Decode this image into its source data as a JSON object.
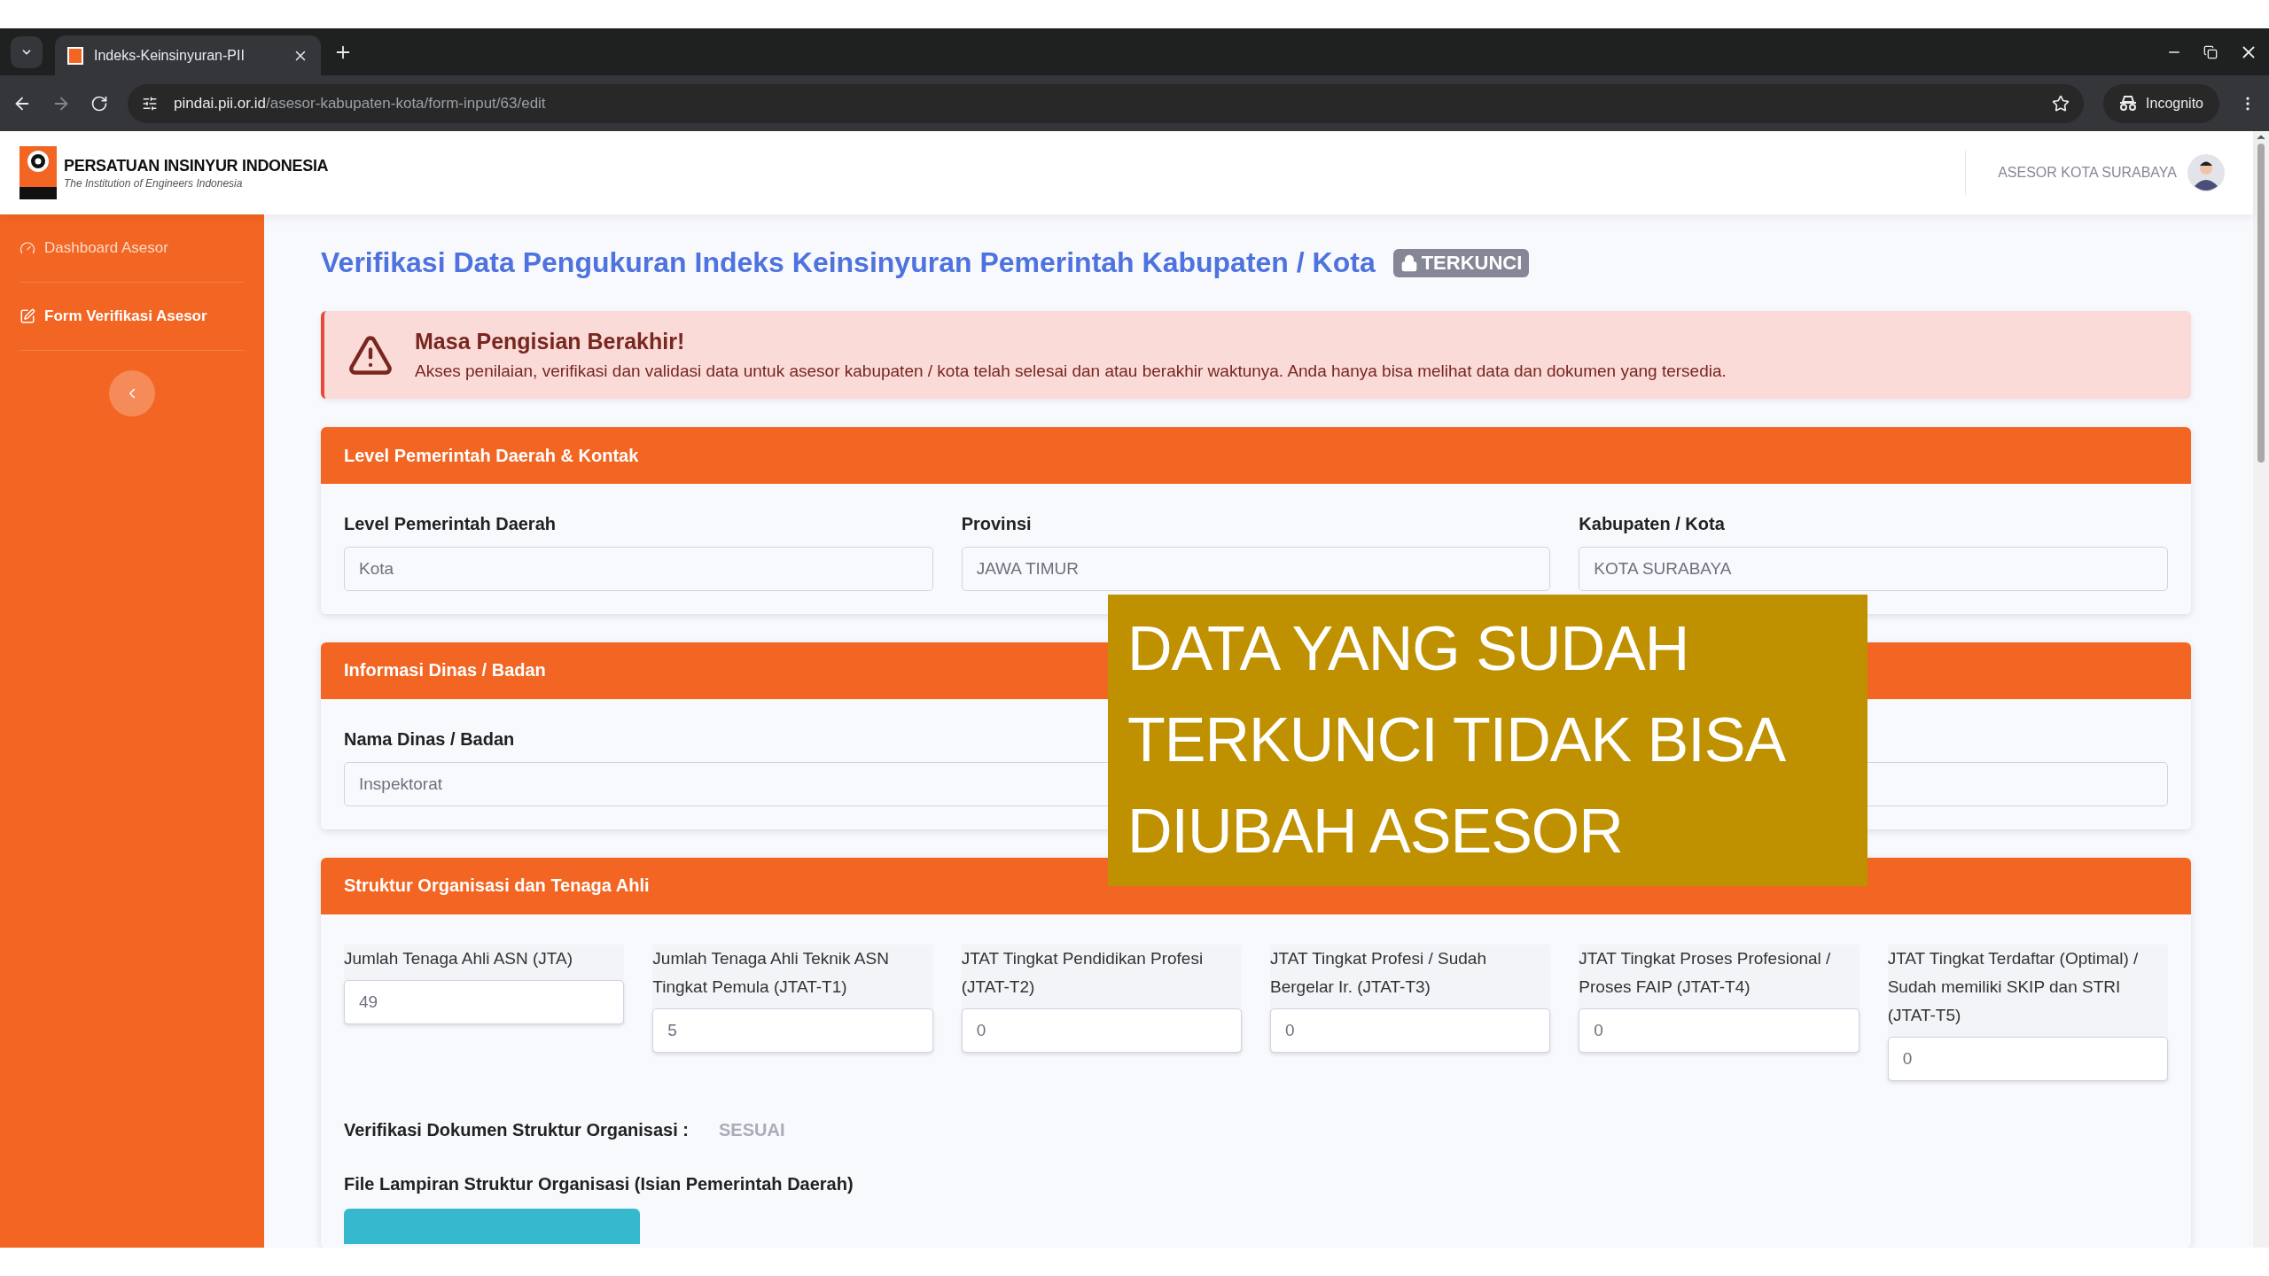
{
  "browser": {
    "tab_title": "Indeks-Keinsinyuran-PII",
    "url_host": "pindai.pii.or.id",
    "url_path": "/asesor-kabupaten-kota/form-input/63/edit",
    "incognito_label": "Incognito"
  },
  "header": {
    "org_name": "PERSATUAN INSINYUR INDONESIA",
    "org_subtitle": "The Institution of Engineers Indonesia",
    "user_name": "ASESOR KOTA SURABAYA"
  },
  "sidebar": {
    "items": [
      {
        "label": "Dashboard Asesor",
        "selected": false
      },
      {
        "label": "Form Verifikasi Asesor",
        "selected": true
      }
    ]
  },
  "page_title": "Verifikasi Data Pengukuran Indeks Keinsinyuran Pemerintah Kabupaten / Kota",
  "status_badge": "TERKUNCI",
  "alert": {
    "title": "Masa Pengisian Berakhir!",
    "message": "Akses penilaian, verifikasi dan validasi data untuk asesor kabupaten / kota telah selesai dan atau berakhir waktunya. Anda hanya bisa melihat data dan dokumen yang tersedia."
  },
  "sections": [
    {
      "kind": "fields",
      "title": "Level Pemerintah Daerah & Kontak",
      "fields": [
        {
          "label": "Level Pemerintah Daerah",
          "value": "Kota"
        },
        {
          "label": "Provinsi",
          "value": "JAWA TIMUR"
        },
        {
          "label": "Kabupaten / Kota",
          "value": "KOTA SURABAYA"
        }
      ]
    },
    {
      "kind": "fields",
      "title": "Informasi Dinas / Badan",
      "fields": [
        {
          "label": "Nama Dinas / Badan",
          "value": "Inspektorat"
        }
      ]
    },
    {
      "kind": "counts",
      "title": "Struktur Organisasi dan Tenaga Ahli",
      "fields": [
        {
          "label": "Jumlah Tenaga Ahli ASN (JTA)",
          "value": "49"
        },
        {
          "label": "Jumlah Tenaga Ahli Teknik ASN Tingkat Pemula (JTAT-T1)",
          "value": "5"
        },
        {
          "label": "JTAT Tingkat Pendidikan Profesi (JTAT-T2)",
          "value": "0"
        },
        {
          "label": "JTAT Tingkat Profesi / Sudah Bergelar Ir. (JTAT-T3)",
          "value": "0"
        },
        {
          "label": "JTAT Tingkat Proses Profesional / Proses FAIP (JTAT-T4)",
          "value": "0"
        },
        {
          "label": "JTAT Tingkat Terdaftar (Optimal) / Sudah memiliki SKIP dan STRI (JTAT-T5)",
          "value": "0"
        }
      ],
      "verification_label": "Verifikasi Dokumen Struktur Organisasi :",
      "verification_value": "SESUAI",
      "file_label": "File Lampiran Struktur Organisasi (Isian Pemerintah Daerah)"
    }
  ],
  "overlay_note": "DATA YANG SUDAH TERKUNCI TIDAK BISA DIUBAH ASESOR"
}
